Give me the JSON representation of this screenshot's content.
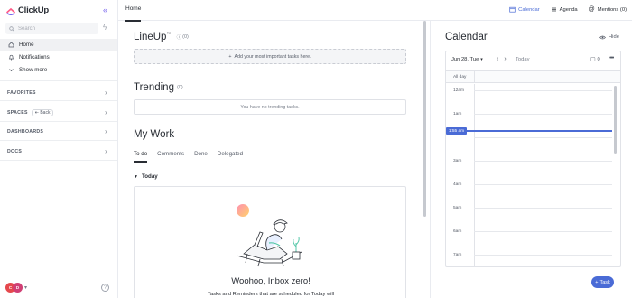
{
  "app": {
    "name": "ClickUp"
  },
  "sidebar": {
    "search_placeholder": "Search",
    "items": [
      {
        "label": "Home",
        "icon": "home-icon",
        "active": true
      },
      {
        "label": "Notifications",
        "icon": "bell-icon",
        "active": false
      },
      {
        "label": "Show more",
        "icon": "chevron-down-icon",
        "active": false
      }
    ],
    "sections": [
      {
        "label": "FAVORITES"
      },
      {
        "label": "SPACES",
        "extra": "Back"
      },
      {
        "label": "DASHBOARDS"
      },
      {
        "label": "DOCS"
      }
    ],
    "avatars": [
      {
        "text": "C",
        "color": "#e5484d"
      },
      {
        "text": "D",
        "color": "#d03f74"
      }
    ],
    "help": "?"
  },
  "topbar": {
    "home_tab": "Home",
    "calendar": "Calendar",
    "agenda": "Agenda",
    "mentions": "Mentions (0)"
  },
  "main": {
    "lineup": {
      "title": "LineUp",
      "tm": "™",
      "count": "(0)",
      "add_label": "Add your most important tasks here."
    },
    "trending": {
      "title": "Trending",
      "count": "(0)",
      "empty": "You have no trending tasks."
    },
    "mywork": {
      "title": "My Work",
      "tabs": [
        "To do",
        "Comments",
        "Done",
        "Delegated"
      ],
      "group": "Today",
      "empty_title": "Woohoo, Inbox zero!",
      "empty_sub": "Tasks and Reminders that are scheduled for Today will"
    }
  },
  "calendar": {
    "title": "Calendar",
    "hide": "Hide",
    "date": "Jun 28, Tue",
    "today": "Today",
    "count": "0",
    "all_day": "All day",
    "hours": [
      "12am",
      "1am",
      "2am",
      "3am",
      "4am",
      "5am",
      "6am",
      "7am"
    ],
    "now": "1:55 am"
  },
  "fab": {
    "label": "Task"
  },
  "colors": {
    "accent": "#4a6bd6",
    "brand": "#7b68ee"
  }
}
